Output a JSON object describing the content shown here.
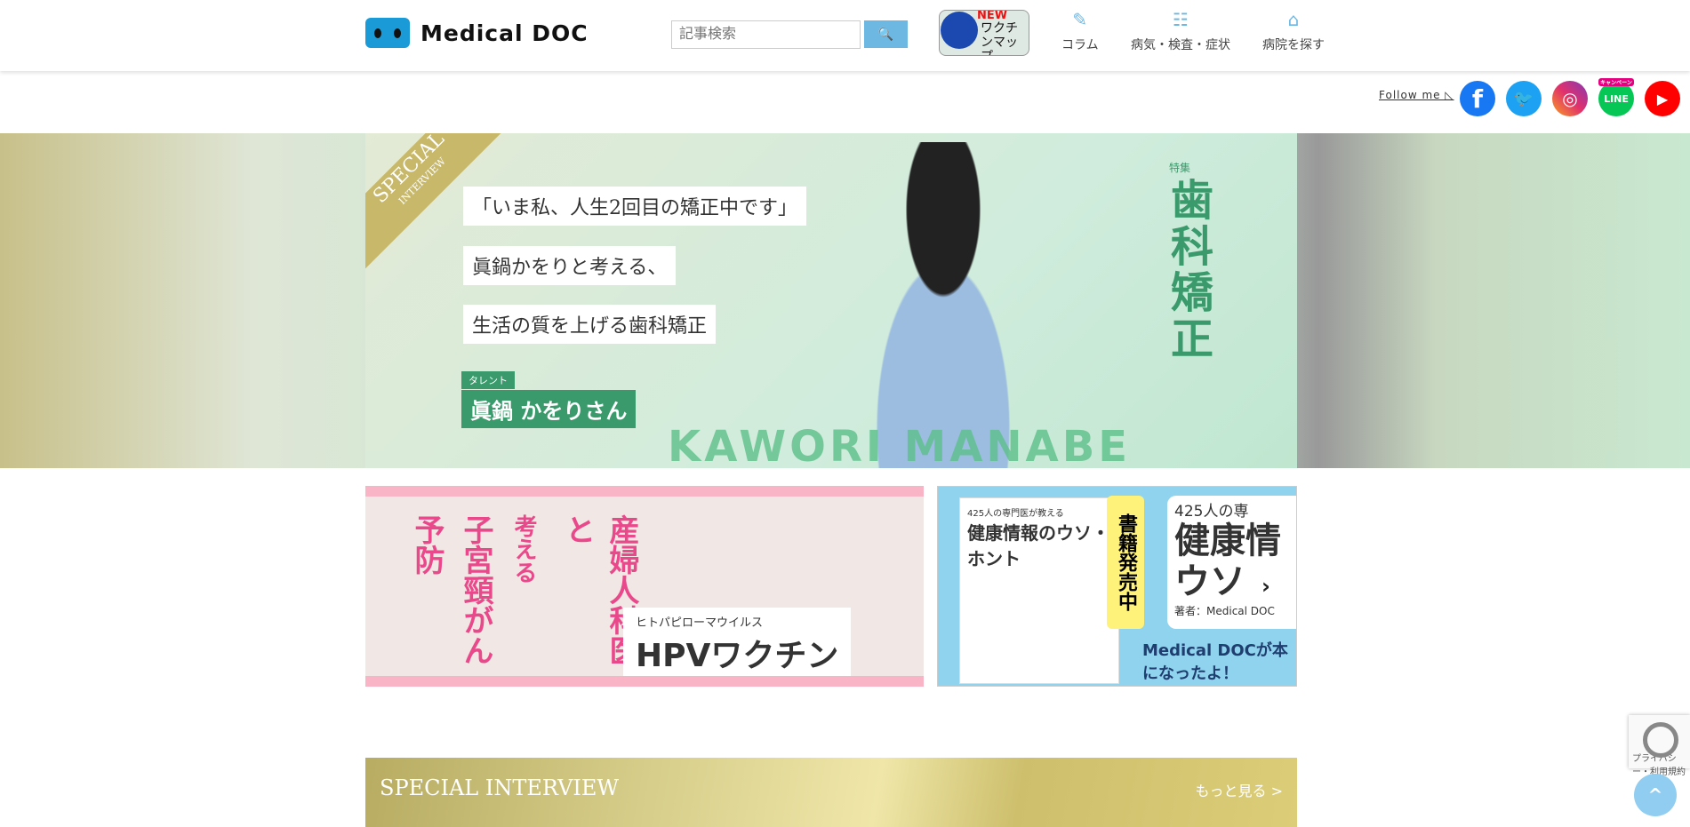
{
  "header": {
    "logo_text": "Medical DOC",
    "search_placeholder": "記事検索",
    "search_button": "🔍",
    "vaccine_map": {
      "badge": "NEW",
      "label": "ワクチンマップ"
    },
    "nav": [
      {
        "label": "コラム",
        "icon": "feather-icon"
      },
      {
        "label": "病気・検査・症状",
        "icon": "checklist-icon"
      },
      {
        "label": "病院を探す",
        "icon": "hospital-icon"
      }
    ]
  },
  "social": {
    "follow_label": "Follow me ◺",
    "items": [
      {
        "name": "facebook",
        "glyph": "f",
        "color": "#1877f2"
      },
      {
        "name": "twitter",
        "glyph": "🐦",
        "color": "#1da1f2"
      },
      {
        "name": "instagram",
        "glyph": "◎",
        "color": "#c13584"
      },
      {
        "name": "line",
        "glyph": "LINE",
        "color": "#06c755",
        "badge": "キャンペーン"
      },
      {
        "name": "youtube",
        "glyph": "▶",
        "color": "#ff0000"
      }
    ]
  },
  "hero": {
    "ribbon": "SPECIAL",
    "ribbon_sub": "INTERVIEW",
    "lines": [
      "「いま私、人生2回目の矯正中です」",
      "眞鍋かをりと考える、",
      "生活の質を上げる歯科矯正"
    ],
    "talent_label": "タレント",
    "name": "眞鍋 かをりさん",
    "name_en": "KAWORI MANABE",
    "feature_label": "特集",
    "feature_title": "歯科矯正"
  },
  "banners": {
    "hpv": {
      "v1": "産婦人科医と",
      "v2": "考える",
      "v3": "子宮頸がん",
      "v4": "予防",
      "sub": "ヒトパピローマウイルス",
      "title": "HPVワクチン"
    },
    "book": {
      "cover": "健康情報のウソ・ホント",
      "cover_sub": "425人の専門医が教える",
      "tag": "書籍発売中",
      "big_sub": "425人の専",
      "big": "健康情 ウソ",
      "author": "著者：Medical DOC",
      "footer": "Medical DOCが本になったよ！"
    },
    "next": "›"
  },
  "section": {
    "title": "SPECIAL INTERVIEW",
    "more": "もっと見る >"
  },
  "recaptcha": "プライバシー・利用規約",
  "back_to_top": "^"
}
